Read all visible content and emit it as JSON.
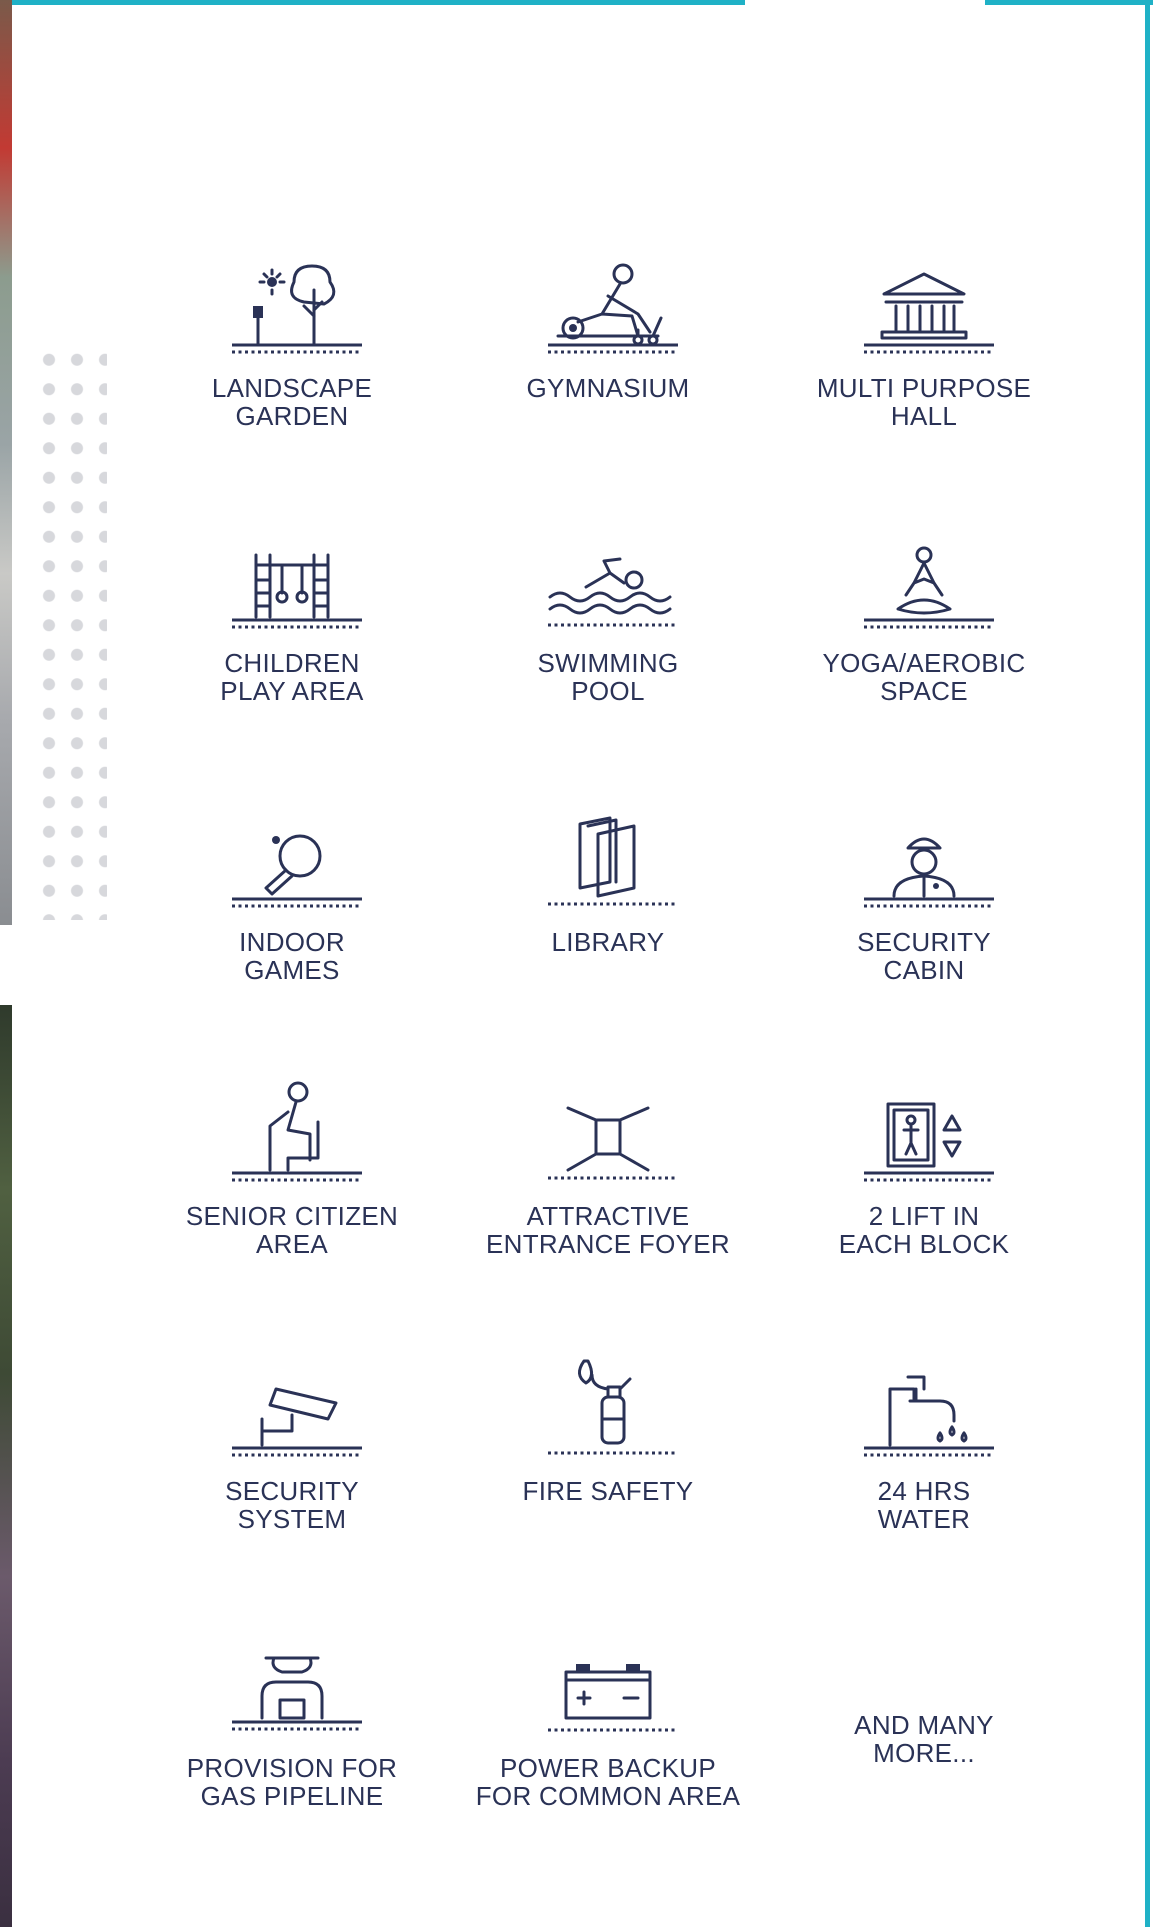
{
  "amenities": [
    {
      "label": "LANDSCAPE\nGARDEN",
      "icon": "tree-lamp-icon"
    },
    {
      "label": "GYMNASIUM",
      "icon": "rowing-machine-icon"
    },
    {
      "label": "MULTI PURPOSE\nHALL",
      "icon": "hall-building-icon"
    },
    {
      "label": "CHILDREN\nPLAY AREA",
      "icon": "climbing-frame-icon"
    },
    {
      "label": "SWIMMING\nPOOL",
      "icon": "swimmer-icon"
    },
    {
      "label": "YOGA/AEROBIC\nSPACE",
      "icon": "yoga-pose-icon"
    },
    {
      "label": "INDOOR\nGAMES",
      "icon": "table-tennis-icon"
    },
    {
      "label": "LIBRARY",
      "icon": "books-icon"
    },
    {
      "label": "SECURITY\nCABIN",
      "icon": "security-guard-icon"
    },
    {
      "label": "SENIOR CITIZEN\nAREA",
      "icon": "seated-elder-icon"
    },
    {
      "label": "ATTRACTIVE\nENTRANCE FOYER",
      "icon": "entrance-foyer-icon"
    },
    {
      "label": "2 LIFT IN\nEACH BLOCK",
      "icon": "elevator-icon"
    },
    {
      "label": "SECURITY\nSYSTEM",
      "icon": "cctv-camera-icon"
    },
    {
      "label": "FIRE SAFETY",
      "icon": "fire-extinguisher-icon"
    },
    {
      "label": "24 HRS\nWATER",
      "icon": "water-tap-icon"
    },
    {
      "label": "PROVISION FOR\nGAS PIPELINE",
      "icon": "gas-valve-icon"
    },
    {
      "label": "POWER BACKUP\nFOR COMMON AREA",
      "icon": "battery-icon"
    },
    {
      "label": "AND MANY\nMORE...",
      "icon": ""
    }
  ],
  "colors": {
    "text": "#2a3256",
    "frame": "#1fb1c6",
    "dots": "#d7d8dc"
  }
}
